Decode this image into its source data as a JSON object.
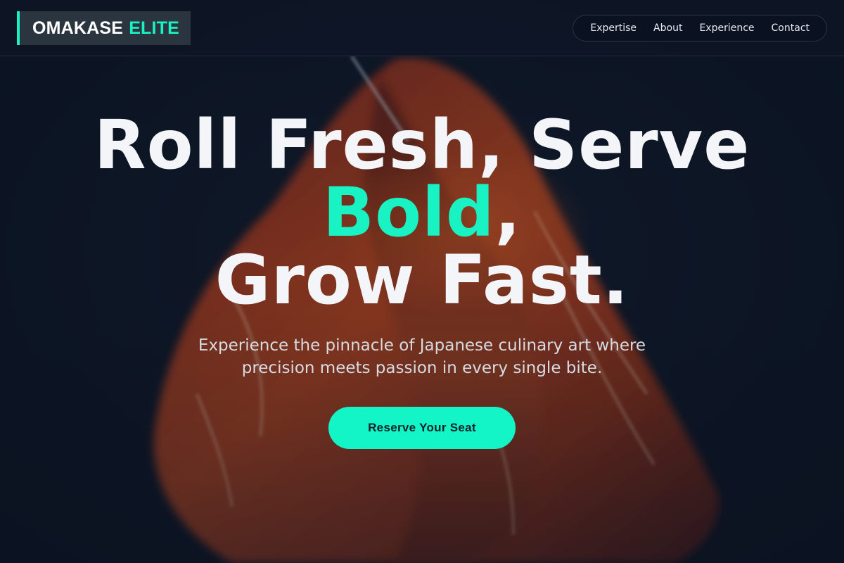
{
  "brand": {
    "name_part1": "OMAKASE",
    "name_part2": "ELITE"
  },
  "nav": {
    "items": [
      {
        "label": "Expertise"
      },
      {
        "label": "About"
      },
      {
        "label": "Experience"
      },
      {
        "label": "Contact"
      }
    ]
  },
  "hero": {
    "headline_line1": "Roll Fresh, Serve",
    "headline_accent": "Bold",
    "headline_comma": ",",
    "headline_line3": "Grow Fast.",
    "subtext_line1": "Experience the pinnacle of Japanese culinary art where",
    "subtext_line2": "precision meets passion in every single bite.",
    "cta_label": "Reserve Your Seat",
    "background": "salmon-sashimi-photo"
  },
  "colors": {
    "accent": "#19f3c4",
    "background": "#0c1524",
    "cta": "#13f5c6"
  }
}
